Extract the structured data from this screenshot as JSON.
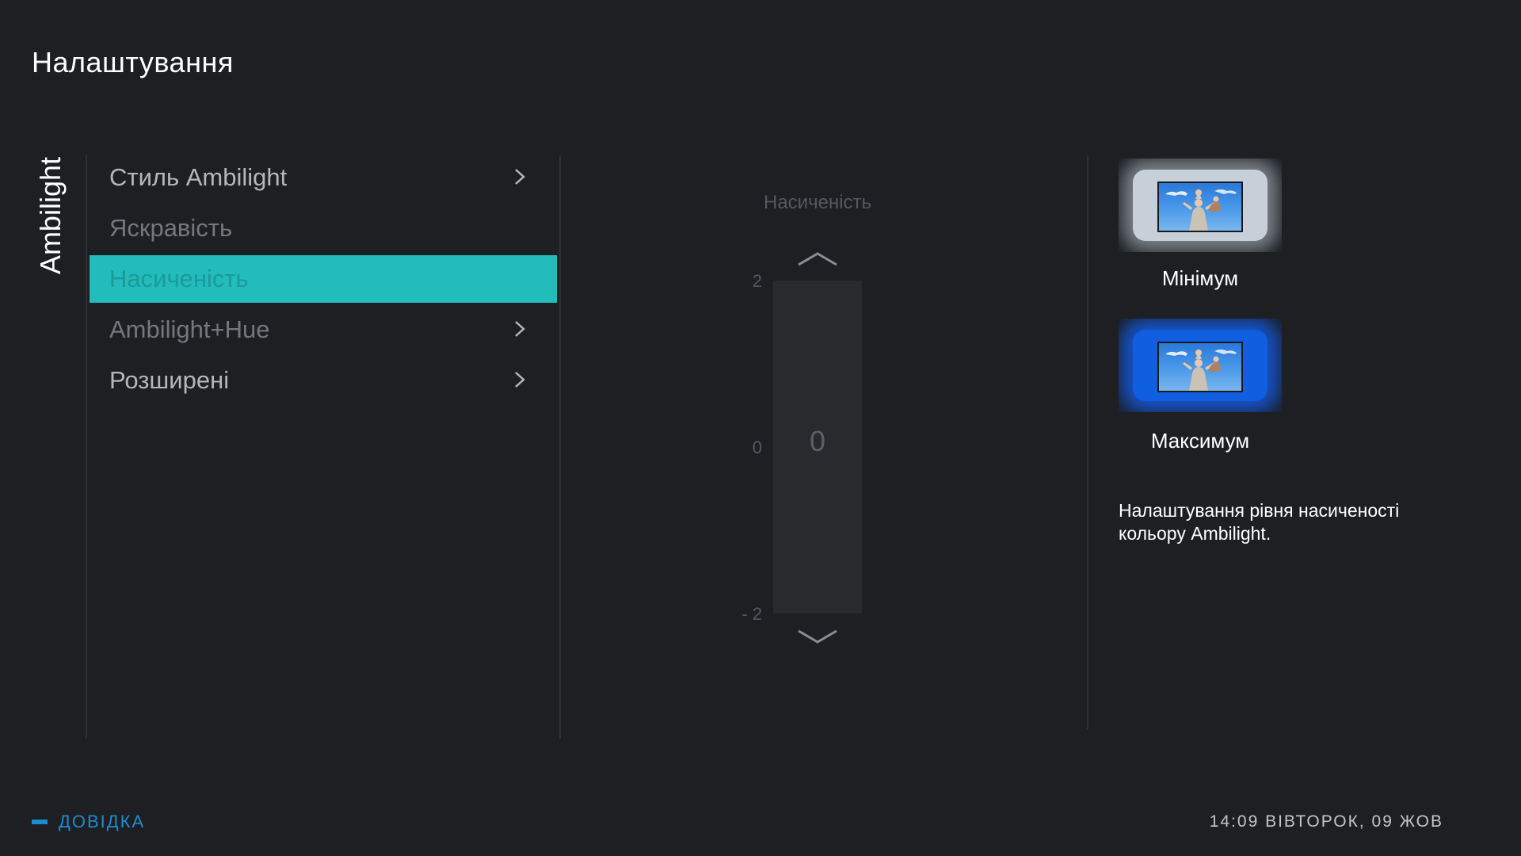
{
  "header": {
    "title": "Налаштування"
  },
  "side_tab": {
    "label": "Ambilight"
  },
  "menu": {
    "items": [
      {
        "label": "Стиль Ambilight",
        "state": "normal",
        "submenu": true
      },
      {
        "label": "Яскравість",
        "state": "disabled",
        "submenu": false
      },
      {
        "label": "Насиченість",
        "state": "selected",
        "submenu": false
      },
      {
        "label": "Ambilight+Hue",
        "state": "disabled",
        "submenu": true
      },
      {
        "label": "Розширені",
        "state": "normal",
        "submenu": true
      }
    ]
  },
  "slider": {
    "title": "Насиченість",
    "max_label": "2",
    "mid_label": "0",
    "min_label": "- 2",
    "value": "0",
    "min": -2,
    "max": 2
  },
  "previews": {
    "min_label": "Мінімум",
    "max_label": "Максимум"
  },
  "description": "Налаштування рівня насиченості кольору Ambilight.",
  "footer": {
    "help_label": "ДОВІДКА",
    "clock": "14:09 ВІВТОРОК, 09 ЖОВ"
  },
  "colors": {
    "background": "#1d1f22",
    "selection": "#22bcbb",
    "help_accent": "#1e8ccf"
  }
}
